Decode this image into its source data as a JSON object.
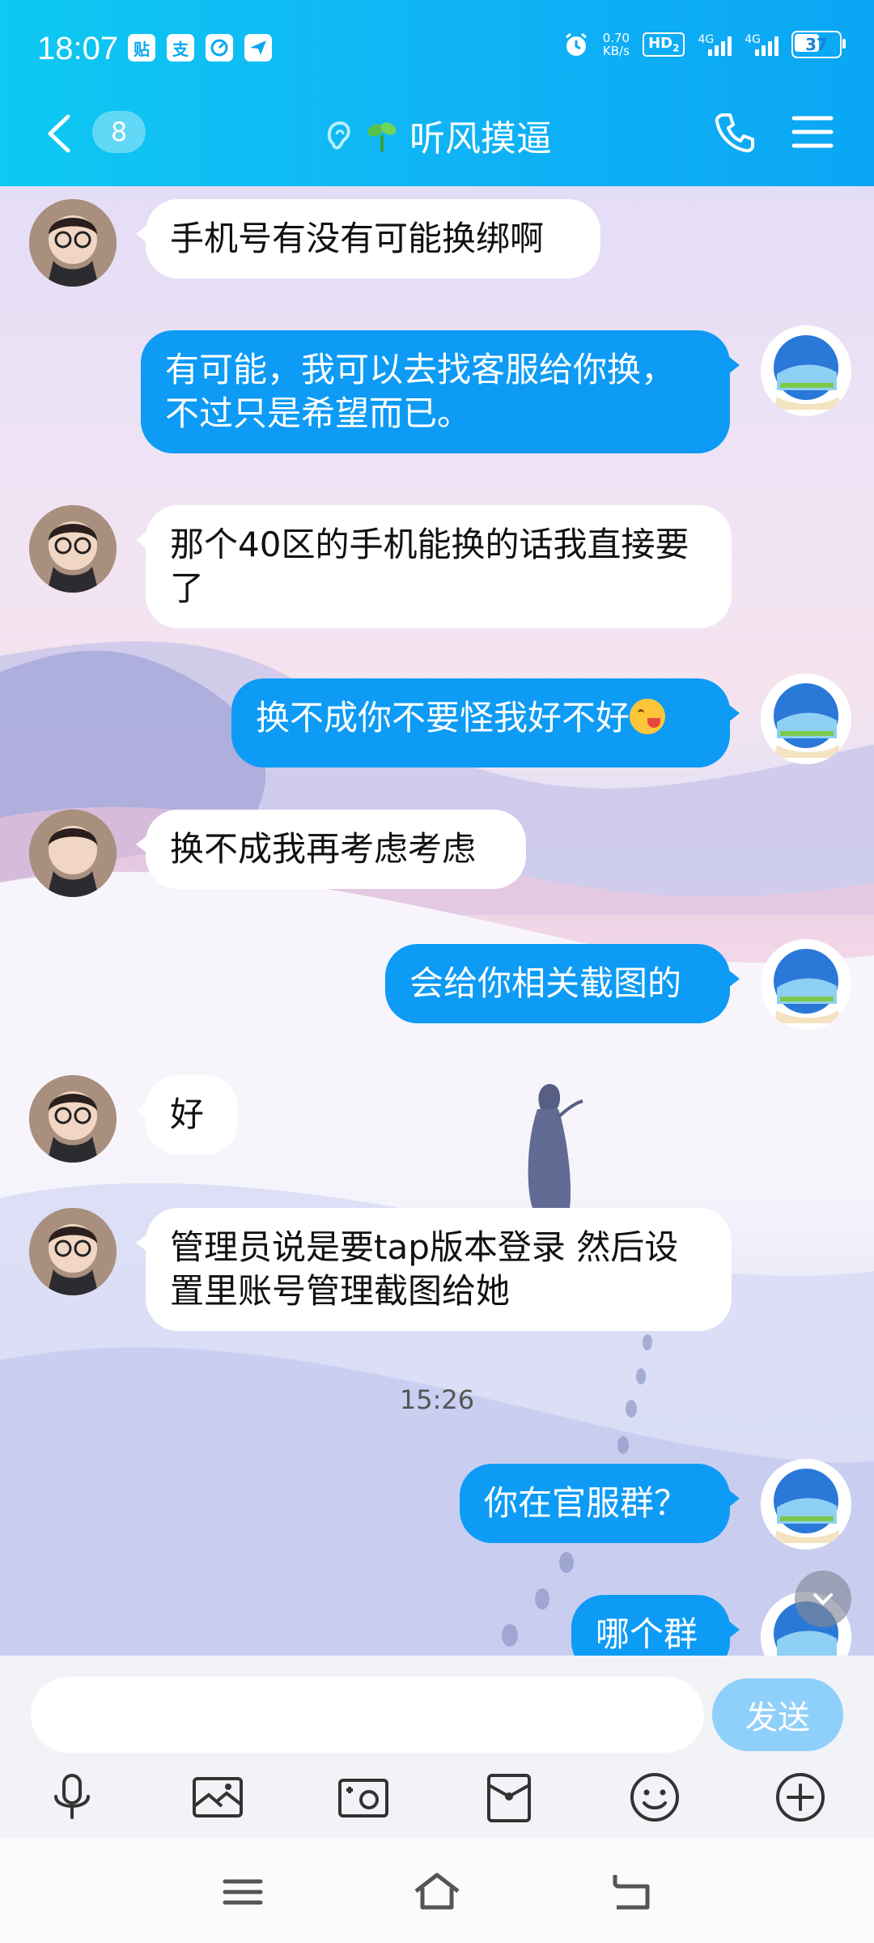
{
  "status_bar": {
    "time": "18:07",
    "net_speed_value": "0.70",
    "net_speed_unit": "KB/s",
    "hd_label": "HD",
    "hd_sub": "2",
    "sim1_label": "4G",
    "sim2_label": "4G",
    "battery": "37",
    "app_icons": [
      "贴",
      "支",
      "",
      ""
    ]
  },
  "header": {
    "unread_count": "8",
    "title": "听风摸逼"
  },
  "messages": [
    {
      "side": "in",
      "text": "手机号有没有可能换绑啊"
    },
    {
      "side": "out",
      "text": "有可能，我可以去找客服给你换，不过只是希望而已。"
    },
    {
      "side": "in",
      "text": "那个40区的手机能换的话我直接要了"
    },
    {
      "side": "out",
      "text": "换不成你不要怪我好不好"
    },
    {
      "side": "in",
      "text": "换不成我再考虑考虑"
    },
    {
      "side": "out",
      "text": "会给你相关截图的"
    },
    {
      "side": "in",
      "text": "好"
    },
    {
      "side": "in",
      "text": "管理员说是要tap版本登录   然后设置里账号管理截图给她"
    },
    {
      "side": "out",
      "text": "你在官服群？"
    },
    {
      "side": "out",
      "text": "哪个群"
    }
  ],
  "timestamp": "15:26",
  "composer": {
    "placeholder": "",
    "send_label": "发送"
  },
  "colors": {
    "header": "#10b4f5",
    "outgoing_bubble": "#0d9bf5",
    "incoming_bubble": "#ffffff",
    "send_button": "#8fd0fb"
  }
}
